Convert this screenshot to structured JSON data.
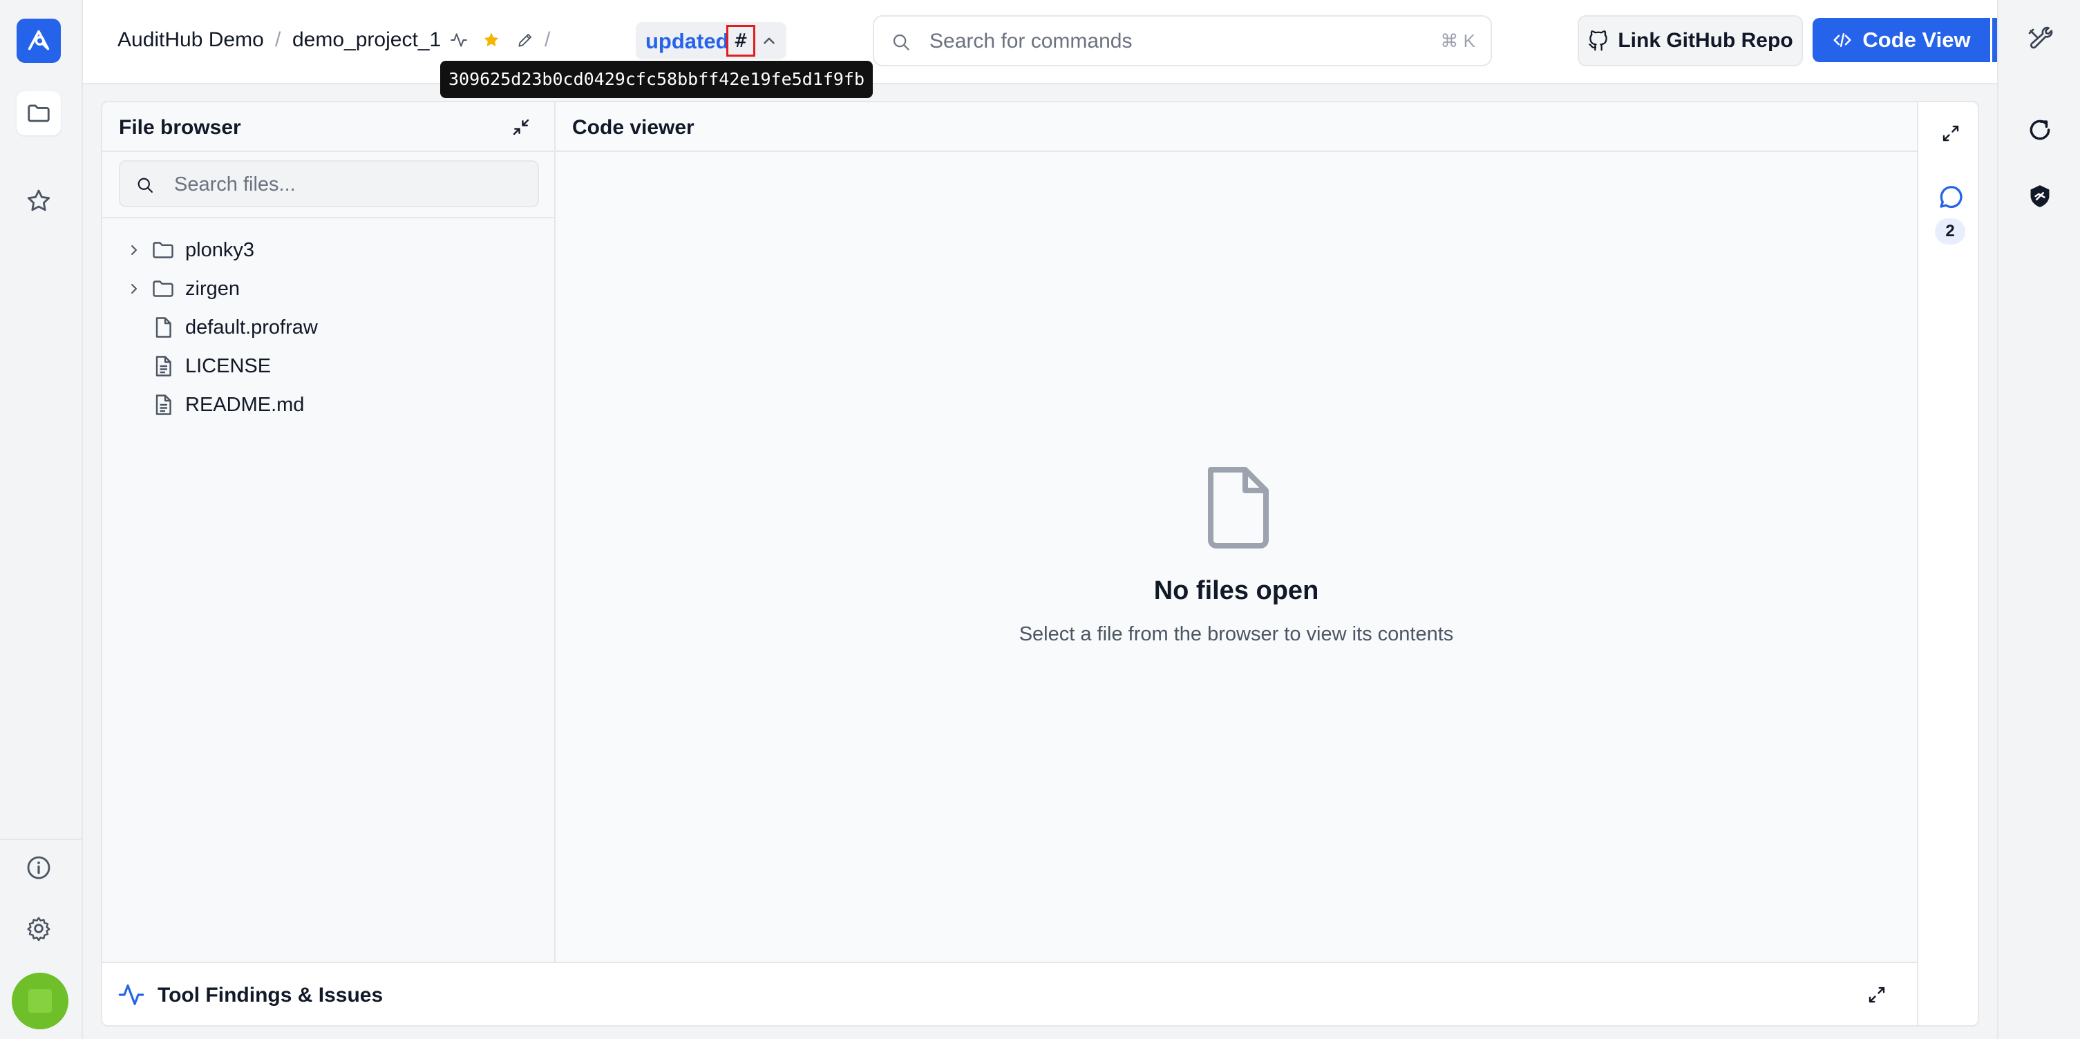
{
  "header": {
    "org": "AuditHub Demo",
    "separator": "/",
    "project": "demo_project_1",
    "branch": "updated",
    "hash_symbol": "#",
    "commit_hash_tooltip": "309625d23b0cd0429cfc58bbff42e19fe5d1f9fb"
  },
  "search": {
    "placeholder": "Search for commands",
    "shortcut": "⌘ K"
  },
  "actions": {
    "github_label": "Link GitHub Repo",
    "code_view_label": "Code View"
  },
  "file_browser": {
    "title": "File browser",
    "search_placeholder": "Search files...",
    "items": [
      {
        "name": "plonky3",
        "type": "folder"
      },
      {
        "name": "zirgen",
        "type": "folder"
      },
      {
        "name": "default.profraw",
        "type": "file"
      },
      {
        "name": "LICENSE",
        "type": "text-file"
      },
      {
        "name": "README.md",
        "type": "text-file"
      }
    ]
  },
  "code_viewer": {
    "title": "Code viewer",
    "empty_title": "No files open",
    "empty_subtitle": "Select a file from the browser to view its contents"
  },
  "side_tools": {
    "comment_count": "2"
  },
  "findings": {
    "label": "Tool Findings & Issues"
  },
  "colors": {
    "accent": "#2563eb",
    "highlight_border": "#e11d1d",
    "star": "#f5b400",
    "avatar": "#6fbf2a"
  }
}
